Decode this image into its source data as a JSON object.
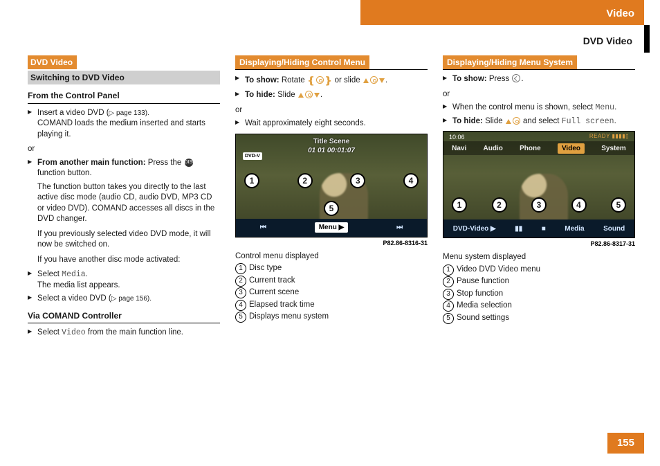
{
  "header": {
    "section": "Video",
    "subsection": "DVD Video",
    "page_number": "155"
  },
  "col1": {
    "box_title": "DVD Video",
    "box_sub": "Switching to DVD Video",
    "h1": "From the Control Panel",
    "s1a": "Insert a video DVD (",
    "s1a_ref": "page 133).",
    "s1b": "COMAND loads the medium inserted and starts playing it.",
    "or1": "or",
    "s2_bold": "From another main function:",
    "s2_tail": " Press the ",
    "s2_tail2": " function button.",
    "s2_p1": "The function button takes you directly to the last active disc mode (audio CD, audio DVD, MP3 CD or video DVD). COMAND accesses all discs in the DVD changer.",
    "s2_p2": "If you previously selected video DVD mode, it will now be switched on.",
    "s2_p3": "If you have another disc mode activated:",
    "s3a": "Select ",
    "s3a_mono": "Media",
    "s3a_tail": ".",
    "s3b": "The media list appears.",
    "s4a": "Select a video DVD (",
    "s4a_ref": "page 156).",
    "h2": "Via COMAND Controller",
    "s5a": "Select ",
    "s5a_mono": "Video",
    "s5a_tail": " from the main function line."
  },
  "col2": {
    "title": "Displaying/Hiding Control Menu",
    "show_bold": "To show:",
    "show_tail1": " Rotate ",
    "show_tail2": " or slide ",
    "show_tail3": ".",
    "hide_bold": "To hide:",
    "hide_tail1": " Slide ",
    "hide_tail2": ".",
    "or": "or",
    "wait": "Wait approximately eight seconds.",
    "fig": {
      "top_label": "Title Scene",
      "top_values": "01   01    00:01:07",
      "dvd_badge": "DVD-V",
      "menu_btn": "Menu ▶",
      "skip_l": "⏮",
      "skip_r": "⏭",
      "id": "P82.86-8316-31"
    },
    "caption": "Control menu displayed",
    "legend": [
      "Disc type",
      "Current track",
      "Current scene",
      "Elapsed track time",
      "Displays menu system"
    ]
  },
  "col3": {
    "title": "Displaying/Hiding Menu System",
    "show_bold": "To show:",
    "show_tail": " Press ",
    "show_tail2": ".",
    "or": "or",
    "when1": "When the control menu is shown, select ",
    "when_mono": "Menu",
    "when_tail": ".",
    "hide_bold": "To hide:",
    "hide_tail1": " Slide ",
    "hide_tail2": " and select ",
    "hide_mono": "Full screen",
    "hide_tail3": ".",
    "fig": {
      "clock": "10:06",
      "ready": "READY ▮▮▮▮▯",
      "nav": [
        "Navi",
        "Audio",
        "Phone",
        "Video",
        "System"
      ],
      "bottom": [
        "DVD-Video ▶",
        "▮▮",
        "■",
        "Media",
        "Sound"
      ],
      "id": "P82.86-8317-31"
    },
    "caption": "Menu system displayed",
    "legend": [
      "Video DVD Video menu",
      "Pause function",
      "Stop function",
      "Media selection",
      "Sound settings"
    ]
  }
}
